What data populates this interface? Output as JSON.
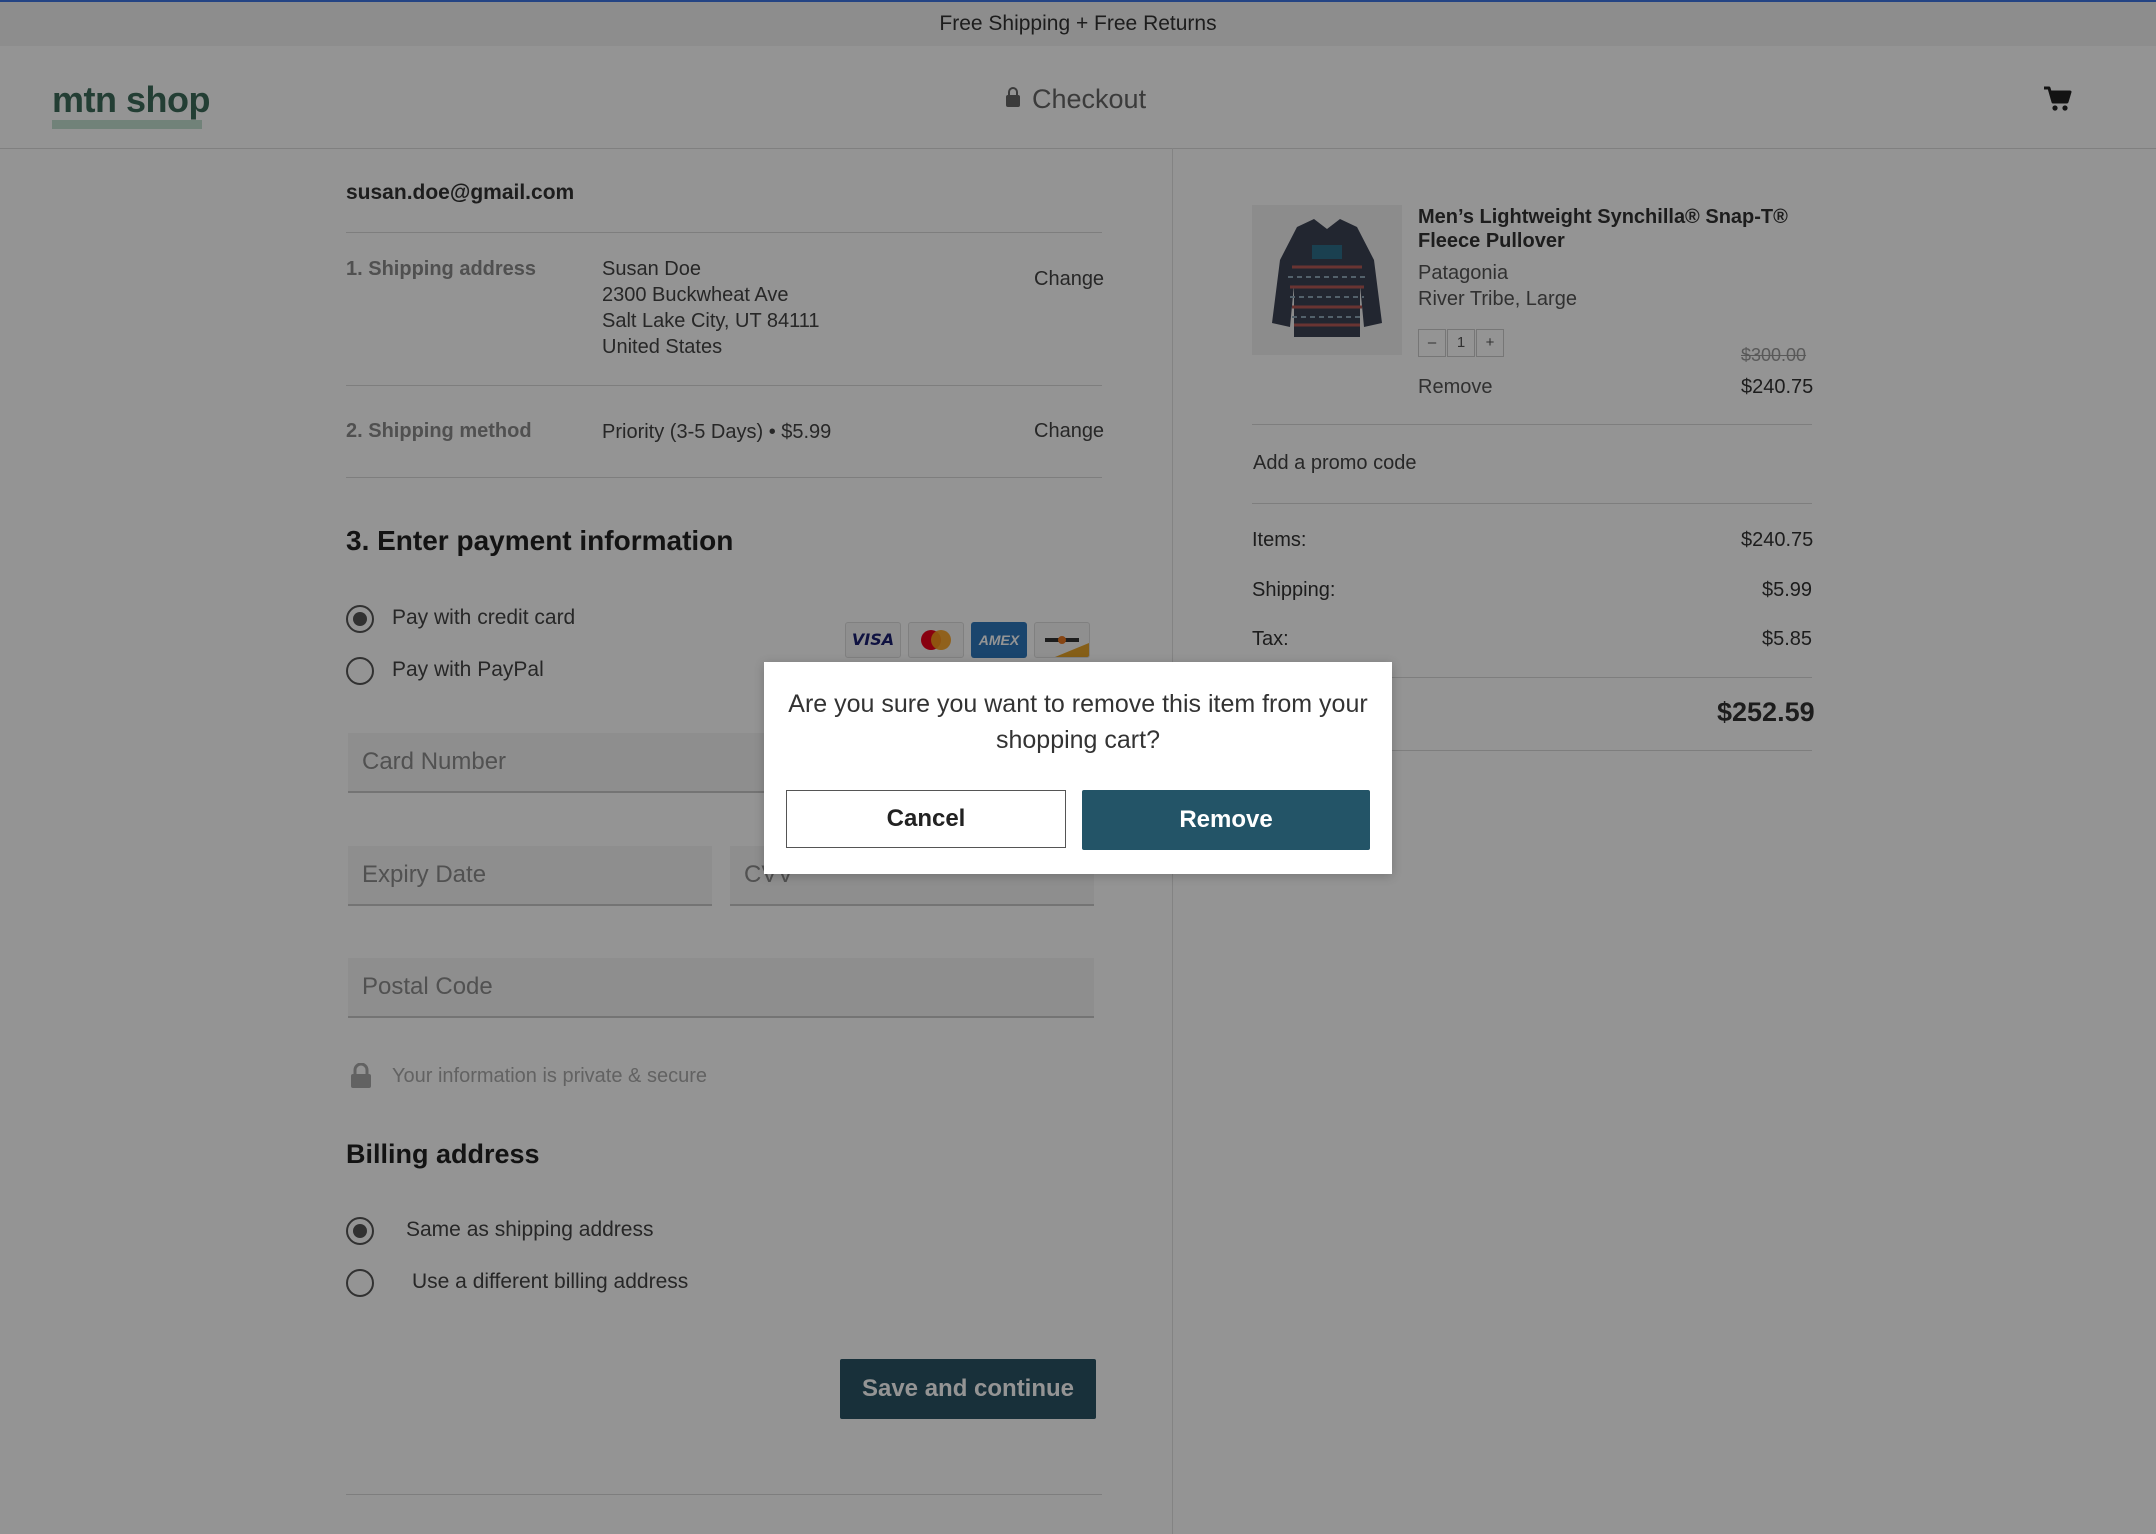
{
  "banner": {
    "text": "Free Shipping + Free Returns"
  },
  "header": {
    "logo": "mtn shop",
    "title": "Checkout"
  },
  "checkout": {
    "email": "susan.doe@gmail.com",
    "shipping_address": {
      "label": "1. Shipping address",
      "lines": [
        "Susan Doe",
        "2300 Buckwheat Ave",
        "Salt Lake City, UT 84111",
        "United States"
      ],
      "change": "Change"
    },
    "shipping_method": {
      "label": "2. Shipping method",
      "value": "Priority (3-5 Days) • $5.99",
      "change": "Change"
    },
    "payment": {
      "title": "3. Enter payment information",
      "options": [
        "Pay with credit card",
        "Pay with PayPal"
      ],
      "selected": "Pay with credit card",
      "card_brands": [
        "VISA",
        "AMEX"
      ],
      "placeholders": {
        "card_number": "Card Number",
        "expiry": "Expiry Date",
        "cvv": "CVV",
        "postal": "Postal Code"
      },
      "secure_note": "Your information is private & secure"
    },
    "billing": {
      "title": "Billing address",
      "options": [
        "Same as shipping address",
        "Use a different billing address"
      ],
      "selected": "Same as shipping address"
    },
    "save_button": "Save and continue"
  },
  "cart": {
    "item": {
      "name": "Men’s Lightweight Synchilla® Snap-T® Fleece Pullover",
      "brand": "Patagonia",
      "variant": "River Tribe, Large",
      "quantity": "1",
      "qty_minus": "–",
      "qty_plus": "+",
      "original_price": "$300.00",
      "price": "$240.75",
      "remove": "Remove"
    },
    "promo": "Add a promo code",
    "summary": {
      "items_label": "Items:",
      "items_value": "$240.75",
      "shipping_label": "Shipping:",
      "shipping_value": "$5.99",
      "tax_label": "Tax:",
      "tax_value": "$5.85",
      "total": "$252.59"
    }
  },
  "modal": {
    "line1": "Are you sure you want to remove this item from your",
    "line2": "shopping cart?",
    "cancel": "Cancel",
    "confirm": "Remove"
  },
  "colors": {
    "accent": "#235467",
    "logo": "#3d6b5a",
    "banner_border": "#3f76e4"
  }
}
